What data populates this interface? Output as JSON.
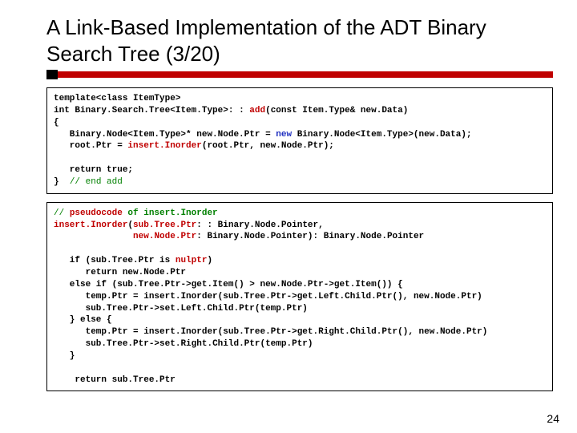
{
  "title": "A Link-Based Implementation of the ADT Binary Search Tree (3/20)",
  "page_number": "24",
  "code1": {
    "l1a": "template<class Item",
    "l1b": "Type>",
    "l2a": "int Binary.",
    "l2b": "Search.",
    "l2c": "Tree<Item.",
    "l2d": "Type>: : ",
    "l2e": "add",
    "l2f": "(const Item.",
    "l2g": "Type& new.",
    "l2h": "Data)",
    "l3": "{",
    "l4a": "   Binary.",
    "l4b": "Node<Item.",
    "l4c": "Type>* new.",
    "l4d": "Node.",
    "l4e": "Ptr = ",
    "l4f": "new",
    "l4g": " Binary.",
    "l4h": "Node<Item.",
    "l4i": "Type>(new.",
    "l4j": "Data);",
    "l5a": "   root.",
    "l5b": "Ptr = ",
    "l5c": "insert.",
    "l5d": "Inorder",
    "l5e": "(root.",
    "l5f": "Ptr, new.",
    "l5g": "Node.",
    "l5h": "Ptr);",
    "l6": "",
    "l7": "   return true;",
    "l8a": "}  ",
    "l8b": "// end add"
  },
  "code2": {
    "l1a": "// ",
    "l1b": "pseudocode",
    "l1c": " of insert.",
    "l1d": "Inorder",
    "l2a": "insert.",
    "l2b": "Inorder",
    "l2c": "(",
    "l2d": "sub.",
    "l2e": "Tree.",
    "l2f": "Ptr",
    "l2g": ": : Binary.",
    "l2h": "Node.",
    "l2i": "Pointer,",
    "l3a": "               ",
    "l3b": "new.",
    "l3c": "Node.",
    "l3d": "Ptr",
    "l3e": ": Binary.",
    "l3f": "Node.",
    "l3g": "Pointer): Binary.",
    "l3h": "Node.",
    "l3i": "Pointer",
    "l4": "",
    "l5a": "   if (sub.",
    "l5b": "Tree.",
    "l5c": "Ptr is ",
    "l5d": "nulptr",
    "l5e": ")",
    "l6a": "      return new.",
    "l6b": "Node.",
    "l6c": "Ptr",
    "l7a": "   else if (sub.",
    "l7b": "Tree.",
    "l7c": "Ptr->get.",
    "l7d": "Item() > new.",
    "l7e": "Node.",
    "l7f": "Ptr->get.",
    "l7g": "Item()) {",
    "l8a": "      temp.",
    "l8b": "Ptr = insert.",
    "l8c": "Inorder(sub.",
    "l8d": "Tree.",
    "l8e": "Ptr->get.",
    "l8f": "Left.",
    "l8g": "Child.",
    "l8h": "Ptr(), new.",
    "l8i": "Node.",
    "l8j": "Ptr)",
    "l9a": "      sub.",
    "l9b": "Tree.",
    "l9c": "Ptr->set.",
    "l9d": "Left.",
    "l9e": "Child.",
    "l9f": "Ptr(temp.",
    "l9g": "Ptr)",
    "l10": "   } else {",
    "l11a": "      temp.",
    "l11b": "Ptr = insert.",
    "l11c": "Inorder(sub.",
    "l11d": "Tree.",
    "l11e": "Ptr->get.",
    "l11f": "Right.",
    "l11g": "Child.",
    "l11h": "Ptr(), new.",
    "l11i": "Node.",
    "l11j": "Ptr)",
    "l12a": "      sub.",
    "l12b": "Tree.",
    "l12c": "Ptr->set.",
    "l12d": "Right.",
    "l12e": "Child.",
    "l12f": "Ptr(temp.",
    "l12g": "Ptr)",
    "l13": "   }",
    "l14": "",
    "l15a": "    return sub.",
    "l15b": "Tree.",
    "l15c": "Ptr"
  }
}
